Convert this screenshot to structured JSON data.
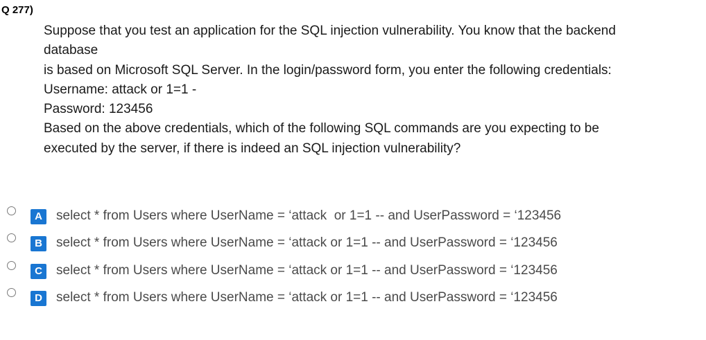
{
  "question": {
    "number": "Q 277)",
    "lines": [
      "Suppose that you test an application for the SQL injection vulnerability. You know that the backend",
      "database",
      "is based on Microsoft SQL Server. In the login/password form, you enter the following credentials:",
      "Username: attack or 1=1 -",
      "Password: 123456",
      "Based on the above credentials, which of the following SQL commands are you expecting to be",
      "executed by the server, if there is indeed an SQL injection vulnerability?"
    ]
  },
  "options": [
    {
      "letter": "A",
      "text": "select * from Users where UserName = ‘attack  or 1=1 -- and UserPassword = ‘123456"
    },
    {
      "letter": "B",
      "text": "select * from Users where UserName = ‘attack or 1=1 -- and UserPassword = ‘123456"
    },
    {
      "letter": "C",
      "text": "select * from Users where UserName = ‘attack or 1=1 -- and UserPassword = ‘123456"
    },
    {
      "letter": "D",
      "text": "select * from Users where UserName = ‘attack or 1=1 -- and UserPassword = ‘123456"
    }
  ],
  "colors": {
    "letter_badge": "#1976d2",
    "option_text": "#4a4a4a",
    "question_text": "#1a1a1a"
  }
}
